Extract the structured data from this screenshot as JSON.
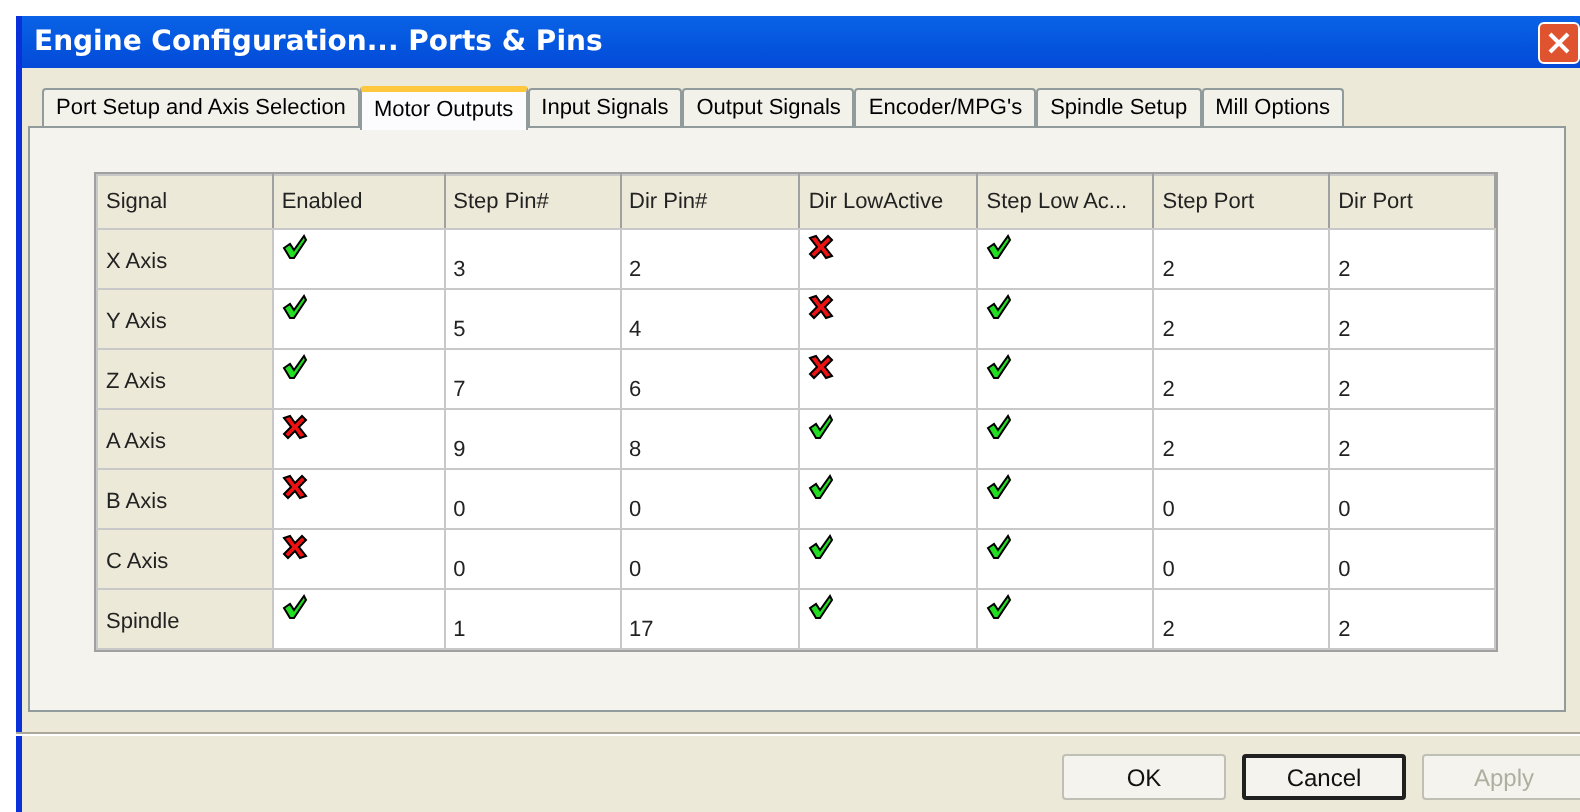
{
  "window": {
    "title": "Engine Configuration... Ports & Pins"
  },
  "tabs": [
    {
      "label": "Port Setup and Axis Selection",
      "selected": false
    },
    {
      "label": "Motor Outputs",
      "selected": true
    },
    {
      "label": "Input Signals",
      "selected": false
    },
    {
      "label": "Output Signals",
      "selected": false
    },
    {
      "label": "Encoder/MPG's",
      "selected": false
    },
    {
      "label": "Spindle Setup",
      "selected": false
    },
    {
      "label": "Mill Options",
      "selected": false
    }
  ],
  "table": {
    "columns": [
      {
        "label": "Signal",
        "kind": "header"
      },
      {
        "label": "Enabled",
        "kind": "check"
      },
      {
        "label": "Step Pin#",
        "kind": "text"
      },
      {
        "label": "Dir Pin#",
        "kind": "text"
      },
      {
        "label": "Dir LowActive",
        "kind": "check"
      },
      {
        "label": "Step Low Ac...",
        "kind": "check"
      },
      {
        "label": "Step Port",
        "kind": "text"
      },
      {
        "label": "Dir Port",
        "kind": "text"
      }
    ],
    "rows": [
      {
        "cells": [
          "X Axis",
          true,
          "3",
          "2",
          false,
          true,
          "2",
          "2"
        ]
      },
      {
        "cells": [
          "Y Axis",
          true,
          "5",
          "4",
          false,
          true,
          "2",
          "2"
        ]
      },
      {
        "cells": [
          "Z Axis",
          true,
          "7",
          "6",
          false,
          true,
          "2",
          "2"
        ]
      },
      {
        "cells": [
          "A Axis",
          false,
          "9",
          "8",
          true,
          true,
          "2",
          "2"
        ]
      },
      {
        "cells": [
          "B Axis",
          false,
          "0",
          "0",
          true,
          true,
          "0",
          "0"
        ]
      },
      {
        "cells": [
          "C Axis",
          false,
          "0",
          "0",
          true,
          true,
          "0",
          "0"
        ]
      },
      {
        "cells": [
          "Spindle",
          true,
          "1",
          "17",
          true,
          true,
          "2",
          "2"
        ]
      }
    ]
  },
  "buttons": [
    {
      "label": "OK",
      "disabled": false,
      "default": false
    },
    {
      "label": "Cancel",
      "disabled": false,
      "default": true
    },
    {
      "label": "Apply",
      "disabled": true,
      "default": false
    }
  ]
}
